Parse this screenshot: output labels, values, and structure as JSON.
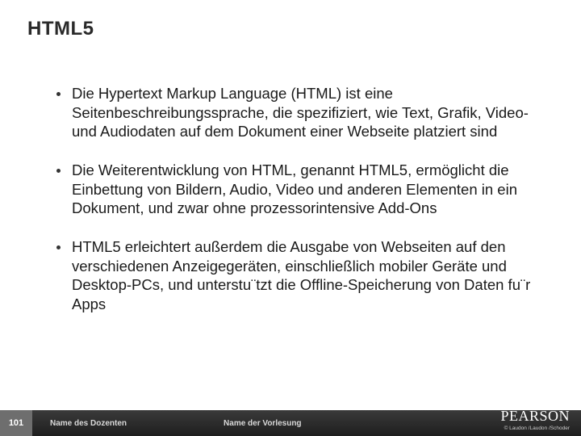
{
  "title": "HTML5",
  "bullets": [
    "Die Hypertext Markup Language (HTML) ist eine Seitenbeschreibungssprache, die spezifiziert, wie Text, Grafik, Video- und Audiodaten auf dem Dokument einer Webseite platziert sind",
    "Die Weiterentwicklung von HTML, genannt HTML5, ermöglicht die Einbettung von Bildern, Audio, Video und anderen Elementen in ein Dokument, und zwar ohne prozessorintensive Add-Ons",
    "HTML5 erleichtert außerdem die Ausgabe von Webseiten auf den verschiedenen Anzeigegeräten, einschließlich mobiler Geräte und Desktop-PCs, und unterstu¨tzt die Offline-Speicherung von Daten fu¨r Apps"
  ],
  "footer": {
    "page": "101",
    "lecturer": "Name des Dozenten",
    "lecture": "Name der Vorlesung",
    "brand": "PEARSON",
    "copyright": "© Laudon /Laudon /Schoder"
  }
}
